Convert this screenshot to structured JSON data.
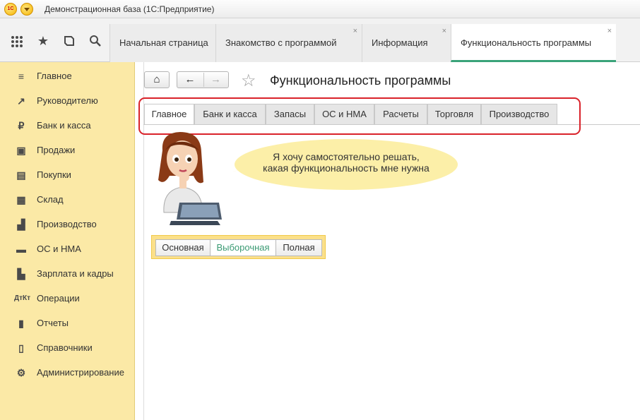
{
  "window": {
    "title": "Демонстрационная база  (1С:Предприятие)",
    "logo_text": "1С"
  },
  "toolbar": {
    "icons": [
      "apps-grid-icon",
      "favorites-star-icon",
      "history-icon",
      "search-icon"
    ],
    "tabs": [
      {
        "label": "Начальная страница",
        "closable": false
      },
      {
        "label": "Знакомство с программой",
        "closable": true
      },
      {
        "label": "Информация",
        "closable": true
      },
      {
        "label": "Функциональность программы",
        "closable": true,
        "active": true
      }
    ],
    "close_glyph": "×",
    "active_tab_color": "#3aa37a"
  },
  "sidebar": {
    "background": "#fbe9a6",
    "items": [
      {
        "label": "Главное",
        "icon": "menu-lines-icon"
      },
      {
        "label": "Руководителю",
        "icon": "trend-icon"
      },
      {
        "label": "Банк и касса",
        "icon": "ruble-icon"
      },
      {
        "label": "Продажи",
        "icon": "bag-icon"
      },
      {
        "label": "Покупки",
        "icon": "cart-icon"
      },
      {
        "label": "Склад",
        "icon": "warehouse-icon"
      },
      {
        "label": "Производство",
        "icon": "factory-icon"
      },
      {
        "label": "ОС и НМА",
        "icon": "truck-icon"
      },
      {
        "label": "Зарплата и кадры",
        "icon": "person-icon"
      },
      {
        "label": "Операции",
        "icon": "operations-icon"
      },
      {
        "label": "Отчеты",
        "icon": "bar-chart-icon"
      },
      {
        "label": "Справочники",
        "icon": "books-icon"
      },
      {
        "label": "Администрирование",
        "icon": "gear-icon"
      }
    ]
  },
  "page": {
    "title": "Функциональность программы",
    "section_tabs": [
      {
        "label": "Главное",
        "active": true
      },
      {
        "label": "Банк и касса"
      },
      {
        "label": "Запасы"
      },
      {
        "label": "ОС и НМА"
      },
      {
        "label": "Расчеты"
      },
      {
        "label": "Торговля"
      },
      {
        "label": "Производство"
      }
    ],
    "highlight_color": "#d9222a",
    "bubble_line1": "Я хочу самостоятельно решать,",
    "bubble_line2": "какая функциональность мне нужна",
    "modes": [
      {
        "label": "Основная"
      },
      {
        "label": "Выборочная",
        "selected": true
      },
      {
        "label": "Полная"
      }
    ],
    "selected_mode_color": "#3a9a74"
  }
}
